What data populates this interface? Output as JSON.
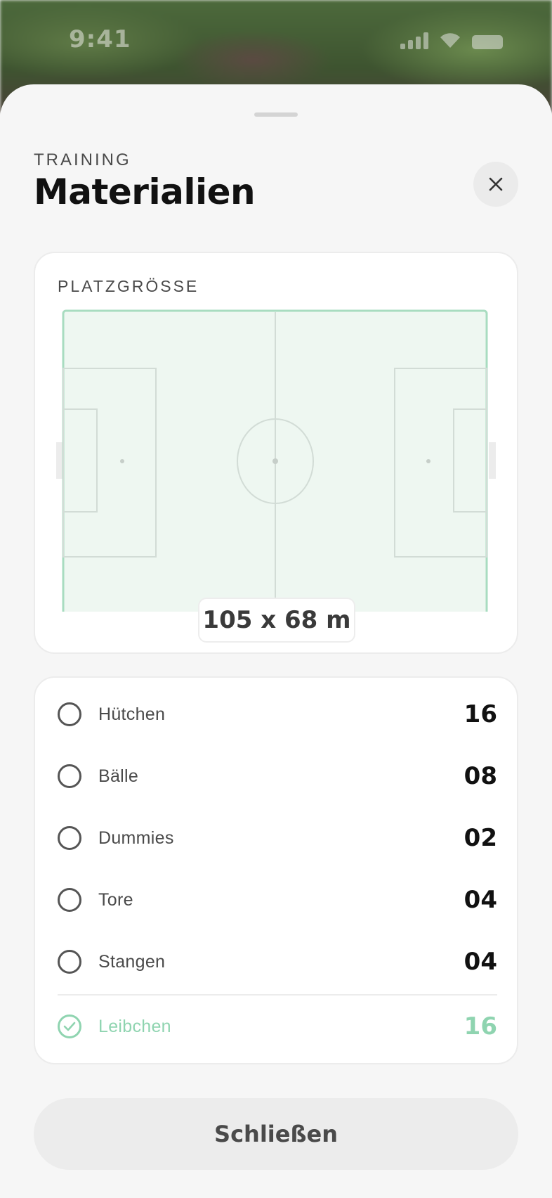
{
  "status_bar": {
    "time": "9:41"
  },
  "header": {
    "eyebrow": "TRAINING",
    "title": "Materialien"
  },
  "pitch_card": {
    "label": "PLATZGRÖSSE",
    "size": "105 x 68 m"
  },
  "materials": [
    {
      "label": "Hütchen",
      "count": "16",
      "checked": false
    },
    {
      "label": "Bälle",
      "count": "08",
      "checked": false
    },
    {
      "label": "Dummies",
      "count": "02",
      "checked": false
    },
    {
      "label": "Tore",
      "count": "04",
      "checked": false
    },
    {
      "label": "Stangen",
      "count": "04",
      "checked": false
    },
    {
      "label": "Leibchen",
      "count": "16",
      "checked": true
    }
  ],
  "footer": {
    "close_label": "Schließen"
  },
  "colors": {
    "accent": "#8fd4b0",
    "pitch_fill": "#eef7f1"
  },
  "icons": {
    "close": "close-icon",
    "radio": "radio-empty-icon",
    "check": "check-circle-icon"
  }
}
